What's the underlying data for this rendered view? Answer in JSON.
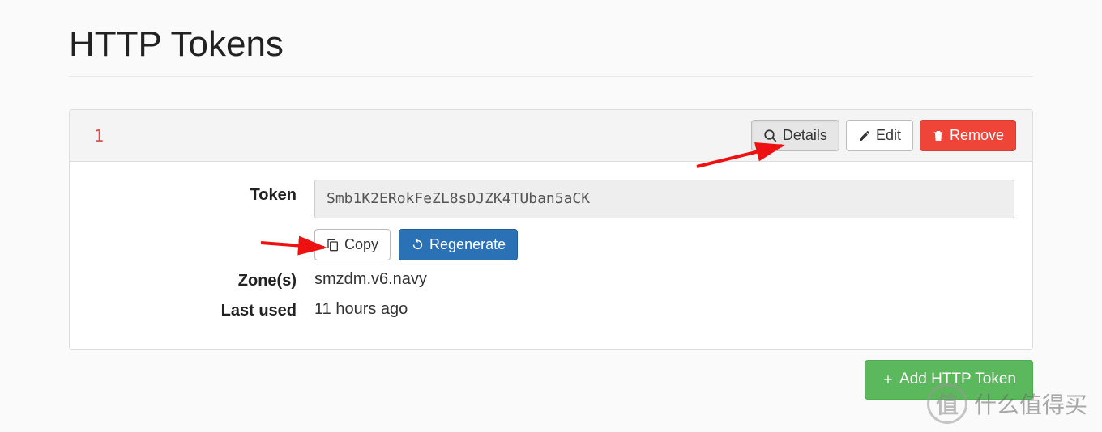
{
  "page": {
    "title": "HTTP Tokens"
  },
  "panel": {
    "index": "1",
    "buttons": {
      "details": "Details",
      "edit": "Edit",
      "remove": "Remove"
    },
    "fields": {
      "token_label": "Token",
      "token_value": "Smb1K2ERokFeZL8sDJZK4TUban5aCK",
      "copy": "Copy",
      "regenerate": "Regenerate",
      "zones_label": "Zone(s)",
      "zones_value": "smzdm.v6.navy",
      "lastused_label": "Last used",
      "lastused_value": "11 hours ago"
    }
  },
  "footer": {
    "add_button": "Add HTTP Token"
  },
  "watermark": {
    "badge": "值",
    "text": "什么值得买"
  }
}
